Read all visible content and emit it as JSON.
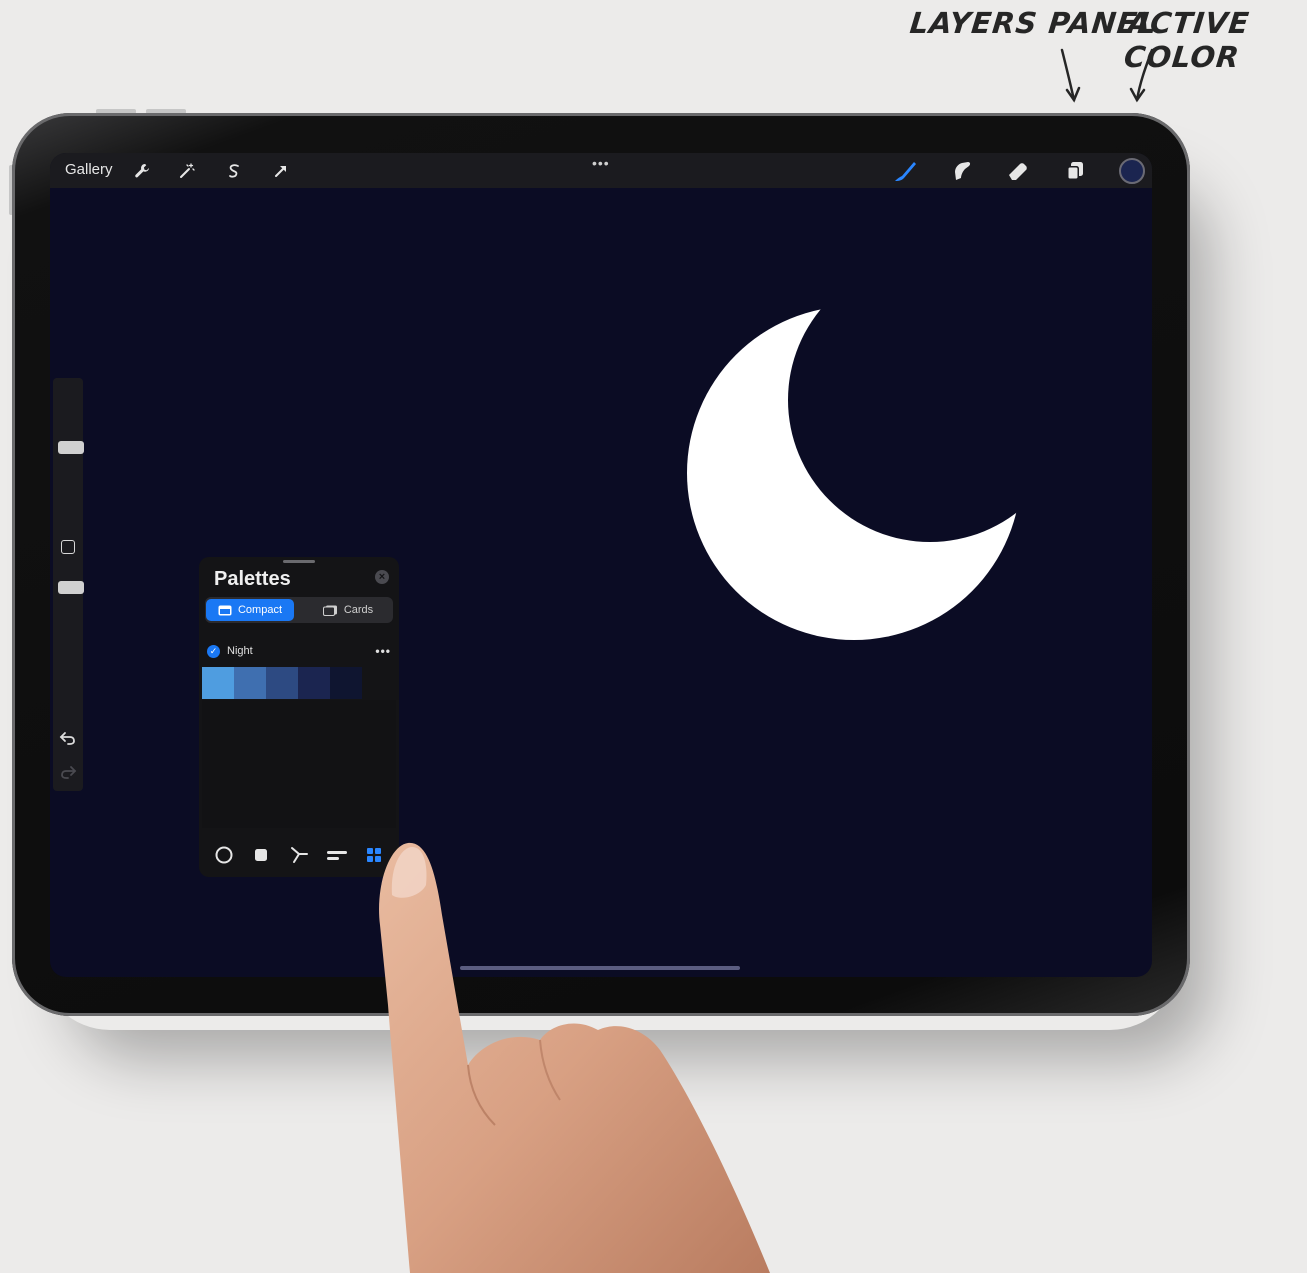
{
  "annotations": {
    "layers_label": "LAYERS PANEL",
    "color_label": "ACTIVE COLOR"
  },
  "toolbar": {
    "gallery_label": "Gallery",
    "left_icons": [
      "wrench-icon",
      "magic-wand-icon",
      "selection-icon",
      "transform-arrow-icon"
    ],
    "more_label": "•••",
    "right_icons": [
      "brush-icon",
      "smudge-icon",
      "eraser-icon",
      "layers-icon"
    ],
    "active_color": "#1b2550",
    "brush_color": "#2a86ff"
  },
  "sidebar": {
    "size_slider_level": 0.5,
    "opacity_slider_level": 0.95,
    "undo_icon": "undo-icon",
    "redo_icon": "redo-icon"
  },
  "palettes": {
    "title": "Palettes",
    "tabs": [
      {
        "label": "Compact",
        "active": true
      },
      {
        "label": "Cards",
        "active": false
      }
    ],
    "palette_name": "Night",
    "palette_more": "•••",
    "swatches": [
      "#4f9de0",
      "#3f6fb0",
      "#2d4a82",
      "#1b2550",
      "#0f1530"
    ],
    "bottom_tools": [
      "disc-icon",
      "classic-icon",
      "harmony-icon",
      "value-icon",
      "palettes-grid-icon"
    ]
  },
  "canvas": {
    "background": "#0b0c24",
    "shape": "crescent-moon"
  }
}
